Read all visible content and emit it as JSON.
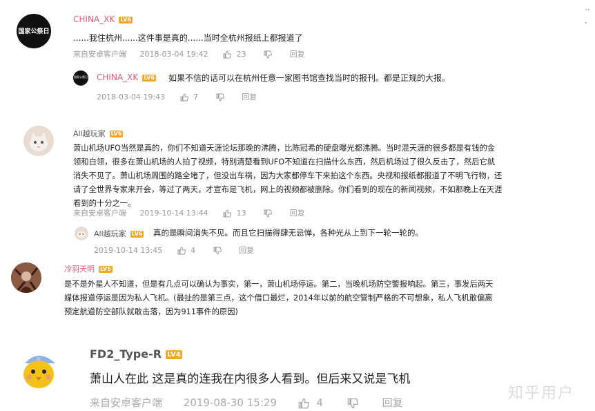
{
  "comments": [
    {
      "username": "CHINA_XK",
      "badge": "LV6",
      "avatar_text": "国家公祭日",
      "text": "......我住杭州......这件事是真的......当时全杭州报纸上都报道了",
      "source": "来自安卓客户端",
      "time": "2018-03-04 19:42",
      "likes": "23",
      "reply_label": "回复",
      "replies": [
        {
          "username": "CHINA_XK",
          "badge": "LV6",
          "avatar_text": "国家公祭日",
          "text": "如果不信的话可以在杭州任意一家图书馆查找当时的报刊。都是正规的大报。",
          "time": "2018-03-04 19:43",
          "likes": "7",
          "reply_label": "回复"
        }
      ]
    },
    {
      "username": "All越玩家",
      "badge": "LV6",
      "text_lines": [
        "萧山机场UFO当然是真的，你们不知道天涯论坛那晚的沸腾，比陈冠希的硬盘曝光都沸腾。当时混天涯的很多都是有钱的金",
        "领和白领，很多在萧山机场的人拍了视频，特别清楚看到UFO不知道在扫描什么东西，然后机场过了很久反击了，然后它就",
        "消失不见了。萧山机场周围的路全堵了，但没出车祸，因为大家都停车下来拍这个东西。央视和报纸都报道了不明飞行物，还",
        "请了全世界专家来开会，等过了两天，才宣布是飞机，网上的视频都被删除。你们看到的现在的新闻视频，不如那晚上在天涯",
        "看到的十分之一。"
      ],
      "source": "来自安卓客户端",
      "time": "2019-10-14 13:44",
      "likes": "13",
      "reply_label": "回复",
      "replies": [
        {
          "username": "All越玩家",
          "badge": "LV6",
          "text": "真的是瞬间消失不见。而且它扫描得肆无忌惮，各种光从上到下一轮一轮的。",
          "time": "2019-10-14 13:45",
          "likes": "4",
          "reply_label": "回复"
        }
      ]
    },
    {
      "username": "冷羽天明",
      "badge": "LV5",
      "text_lines": [
        "是不是外星人不知道，但是有几点可以确认为事实，第一，萧山机场停运。第二，当晚机场防空警报响起。第三，事发后两天",
        "媒体报道停运是因为私人飞机。(最扯的是第三点，这个借口最烂，2014年以前的航空管制严格的不可想象，私人飞机敢偏离",
        "预定航道防空部队就敢击落，因为911事件的原因)"
      ]
    },
    {
      "username": "FD2_Type-R",
      "badge": "LV4",
      "text": "萧山人在此 这是真的连我在内很多人看到。但后来又说是飞机",
      "source": "来自安卓客户端",
      "time": "2019-08-30 15:29",
      "likes": "4",
      "reply_label": "回复"
    }
  ],
  "watermark": "知乎用户",
  "colors": {
    "username_pink": "#e05a7a",
    "badge": "#f5a623",
    "meta": "#999999",
    "text": "#222222"
  }
}
